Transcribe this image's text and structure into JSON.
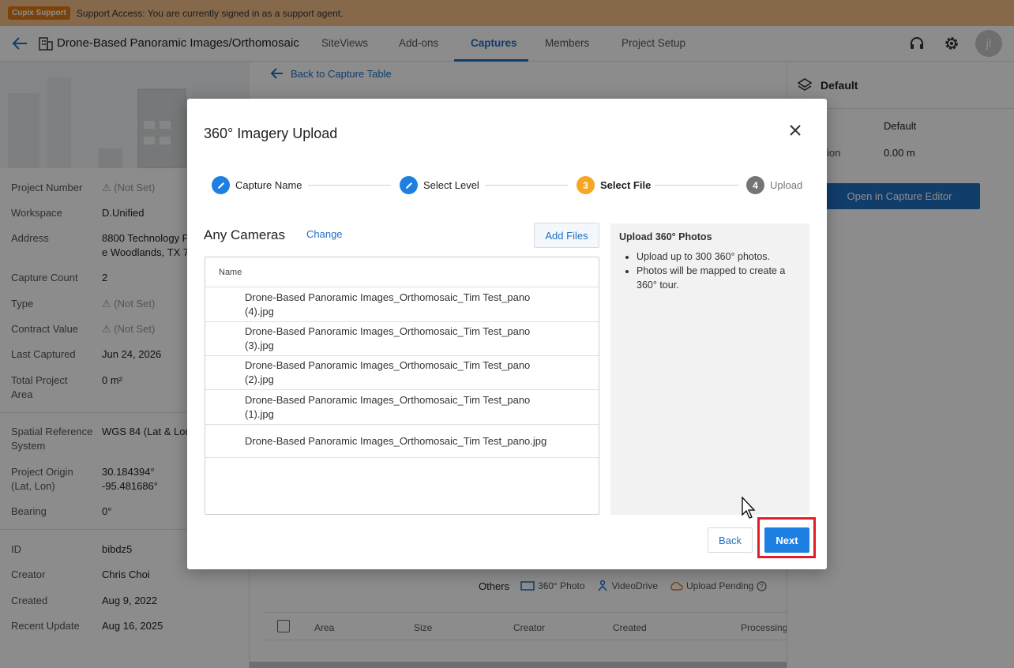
{
  "support": {
    "badge": "Cupix Support",
    "message": "Support Access: You are currently signed in as a support agent."
  },
  "nav": {
    "project_title": "Drone-Based Panoramic Images/Orthomosaic",
    "tabs": [
      {
        "label": "SiteViews"
      },
      {
        "label": "Add-ons"
      },
      {
        "label": "Captures"
      },
      {
        "label": "Members"
      },
      {
        "label": "Project Setup"
      }
    ],
    "active_tab": "Captures",
    "avatar_initial": "jl"
  },
  "project_info": {
    "rows": [
      {
        "label": "Project Number",
        "value": "⚠ (Not Set)"
      },
      {
        "label": "Workspace",
        "value": "D.Unified"
      },
      {
        "label": "Address",
        "value": "8800 Technology F",
        "value2": "e Woodlands, TX 7"
      },
      {
        "label": "Capture Count",
        "value": "2"
      },
      {
        "label": "Type",
        "value": "⚠ (Not Set)"
      },
      {
        "label": "Contract Value",
        "value": "⚠ (Not Set)"
      },
      {
        "label": "Last Captured",
        "value": "Jun 24, 2026"
      },
      {
        "label": "Total Project",
        "label2": "Area",
        "value": "0 m²"
      },
      {
        "label": "Spatial Reference",
        "label2": "System",
        "value": "WGS 84 (Lat & Lon"
      },
      {
        "label": "Project Origin",
        "label2": "(Lat, Lon)",
        "value": "30.184394°",
        "value2": "-95.481686°"
      },
      {
        "label": "Bearing",
        "value": "0°"
      },
      {
        "label": "ID",
        "value": "bibdz5"
      },
      {
        "label": "Creator",
        "value": "Chris Choi"
      },
      {
        "label": "Created",
        "value": "Aug 9, 2022"
      },
      {
        "label": "Recent Update",
        "value": "Aug 16, 2025"
      }
    ]
  },
  "center": {
    "back_link": "Back to Capture Table",
    "legend": {
      "others": "Others",
      "items": [
        "360° Photo",
        "VideoDrive",
        "Upload Pending"
      ]
    },
    "table_headers": [
      "Area",
      "Size",
      "Creator",
      "Created",
      "Processing"
    ]
  },
  "right_panel": {
    "title": "Default",
    "value1": "Default",
    "label2": "ion",
    "value2": "0.00 m",
    "button": "Open in Capture Editor"
  },
  "modal": {
    "title": "360° Imagery Upload",
    "steps": [
      {
        "label": "Capture Name",
        "state": "done"
      },
      {
        "label": "Select Level",
        "state": "done"
      },
      {
        "label": "Select File",
        "number": "3",
        "state": "current"
      },
      {
        "label": "Upload",
        "number": "4",
        "state": "pending"
      }
    ],
    "camera_title": "Any Cameras",
    "change_label": "Change",
    "add_files_label": "Add Files",
    "table_header": "Name",
    "files": [
      "Drone-Based Panoramic Images_Orthomosaic_Tim Test_pano (4).jpg",
      "Drone-Based Panoramic Images_Orthomosaic_Tim Test_pano (3).jpg",
      "Drone-Based Panoramic Images_Orthomosaic_Tim Test_pano (2).jpg",
      "Drone-Based Panoramic Images_Orthomosaic_Tim Test_pano (1).jpg",
      "Drone-Based Panoramic Images_Orthomosaic_Tim Test_pano.jpg"
    ],
    "tips_title": "Upload 360° Photos",
    "tips": [
      "Upload up to 300 360° photos.",
      "Photos will be mapped to create a 360° tour."
    ],
    "back_label": "Back",
    "next_label": "Next"
  },
  "colors": {
    "accent": "#1f6fc4",
    "step_current": "#f5a623",
    "step_pending": "#757575",
    "highlight": "#e01e2a",
    "support_bar": "#f5c089"
  }
}
